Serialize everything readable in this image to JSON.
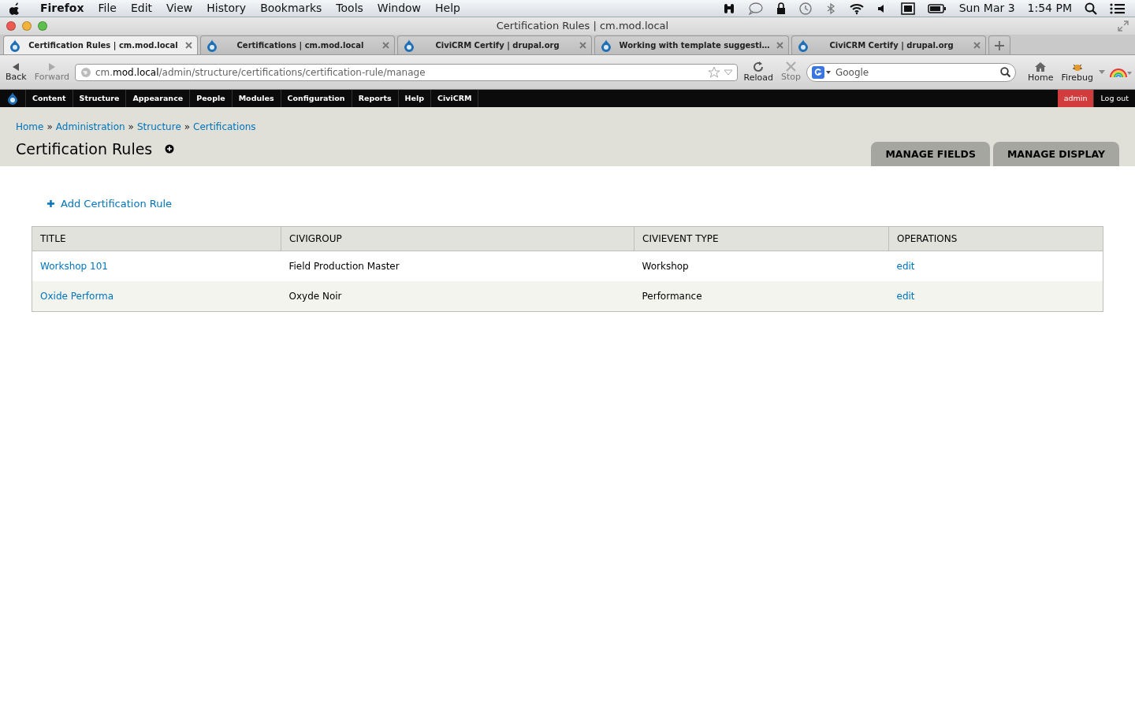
{
  "menubar": {
    "app": "Firefox",
    "menus": [
      "File",
      "Edit",
      "View",
      "History",
      "Bookmarks",
      "Tools",
      "Window",
      "Help"
    ],
    "date": "Sun Mar 3",
    "time": "1:54 PM"
  },
  "window": {
    "title": "Certification Rules | cm.mod.local"
  },
  "browser_tabs": [
    {
      "label": "Certification Rules | cm.mod.local",
      "selected": true
    },
    {
      "label": "Certifications | cm.mod.local",
      "selected": false
    },
    {
      "label": "CiviCRM Certify | drupal.org",
      "selected": false
    },
    {
      "label": "Working with template suggesti…",
      "selected": false
    },
    {
      "label": "CiviCRM Certify | drupal.org",
      "selected": false
    }
  ],
  "toolbar": {
    "back": {
      "label": "Back",
      "disabled": false
    },
    "forward": {
      "label": "Forward",
      "disabled": true
    },
    "url": {
      "subdomain": "cm.",
      "domain": "mod.local",
      "path": "/admin/structure/certifications/certification-rule/manage"
    },
    "reload": {
      "label": "Reload",
      "disabled": false
    },
    "stop": {
      "label": "Stop",
      "disabled": true
    },
    "search": {
      "placeholder": "Google"
    },
    "home": "Home",
    "firebug": "Firebug"
  },
  "admin_toolbar": {
    "items": [
      "Content",
      "Structure",
      "Appearance",
      "People",
      "Modules",
      "Configuration",
      "Reports",
      "Help",
      "CiviCRM"
    ],
    "user": "admin",
    "logout": "Log out"
  },
  "breadcrumb": [
    {
      "kind": "link",
      "text": "Home"
    },
    {
      "kind": "separator",
      "text": "»"
    },
    {
      "kind": "link",
      "text": "Administration"
    },
    {
      "kind": "separator",
      "text": "»"
    },
    {
      "kind": "link",
      "text": "Structure"
    },
    {
      "kind": "separator",
      "text": "»"
    },
    {
      "kind": "link",
      "text": "Certifications"
    }
  ],
  "page_title": "Certification Rules",
  "tabs": [
    {
      "label": "MANAGE FIELDS",
      "selected": false
    },
    {
      "label": "MANAGE DISPLAY",
      "selected": false
    }
  ],
  "action_link": "Add Certification Rule",
  "table": {
    "columns": [
      "TITLE",
      "CIVIGROUP",
      "CIVIEVENT TYPE",
      "OPERATIONS"
    ],
    "rows": [
      {
        "title": "Workshop 101",
        "civigroup": "Field Production Master",
        "event_type": "Workshop",
        "operation": "edit"
      },
      {
        "title": "Oxide Performa",
        "civigroup": "Oxyde Noir",
        "event_type": "Performance",
        "operation": "edit"
      }
    ]
  }
}
